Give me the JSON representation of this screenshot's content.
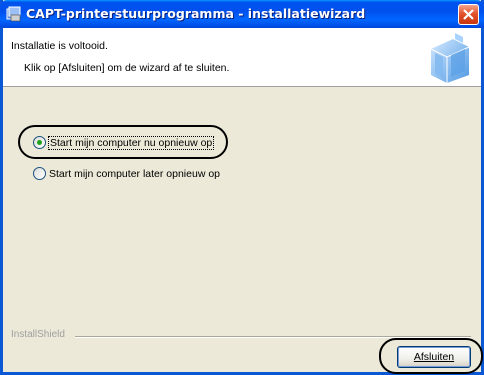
{
  "window": {
    "title": "CAPT-printerstuurprogramma - installatiewizard"
  },
  "header": {
    "title": "Installatie is voltooid.",
    "subtitle": "Klik op [Afsluiten] om de wizard af te sluiten."
  },
  "options": [
    {
      "label": "Start mijn computer nu opnieuw op",
      "checked": true
    },
    {
      "label": "Start mijn computer later opnieuw op",
      "checked": false
    }
  ],
  "footer": {
    "brand": "InstallShield",
    "finish_label": "Afsluiten"
  },
  "icons": {
    "title": "installer-icon",
    "close": "close-icon",
    "header": "cd-box-graphic"
  },
  "colors": {
    "titlebar": "#0053ee",
    "dialog_bg": "#ece9d8",
    "close": "#e2542d",
    "radio_dot": "#21a121"
  }
}
